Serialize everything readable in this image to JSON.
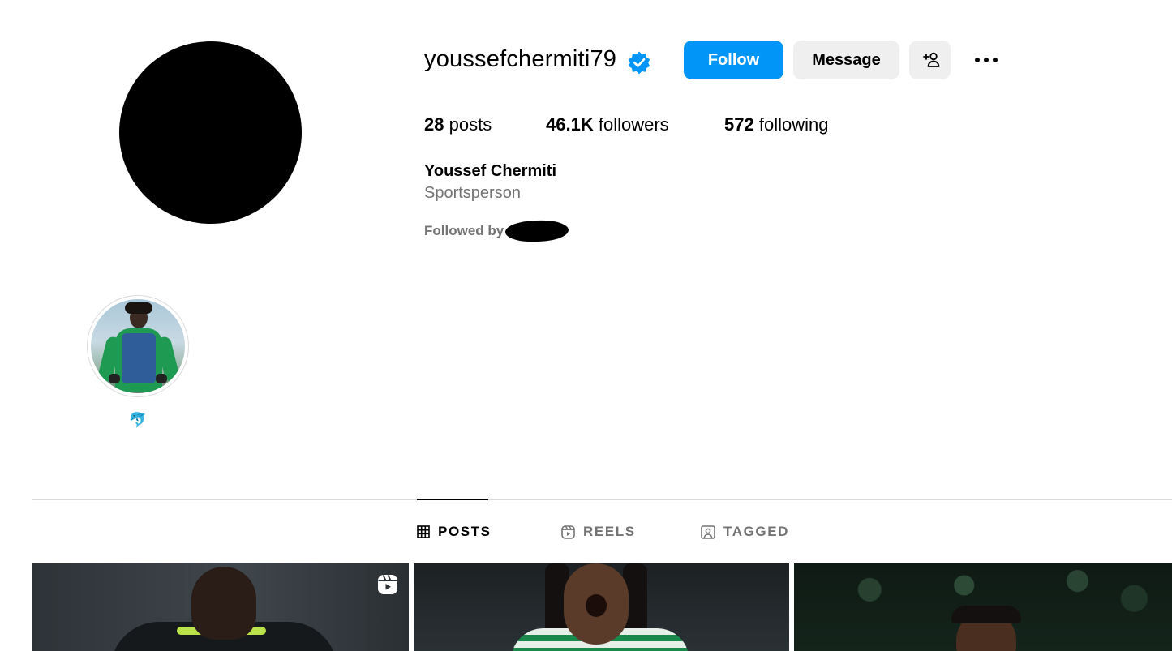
{
  "profile": {
    "username": "youssefchermiti79",
    "verified": true,
    "full_name": "Youssef Chermiti",
    "category": "Sportsperson",
    "followed_by_label": "Followed by",
    "stats": {
      "posts_count": "28",
      "posts_label": "posts",
      "followers_count": "46.1K",
      "followers_label": "followers",
      "following_count": "572",
      "following_label": "following"
    }
  },
  "actions": {
    "follow_label": "Follow",
    "message_label": "Message",
    "add_user_icon": "add-person-icon",
    "more_icon": "more-horizontal-icon"
  },
  "highlights": [
    {
      "title": "🐬"
    }
  ],
  "tabs": [
    {
      "label": "POSTS",
      "icon": "grid-icon",
      "active": true
    },
    {
      "label": "REELS",
      "icon": "reels-icon",
      "active": false
    },
    {
      "label": "TAGGED",
      "icon": "tagged-icon",
      "active": false
    }
  ],
  "posts": [
    {
      "type": "reel"
    },
    {
      "type": "photo"
    },
    {
      "type": "photo"
    }
  ],
  "colors": {
    "accent": "#0095f6",
    "secondary_button": "#efefef",
    "muted_text": "#737373",
    "verified_badge": "#0095f6",
    "divider": "#dbdbdb"
  }
}
